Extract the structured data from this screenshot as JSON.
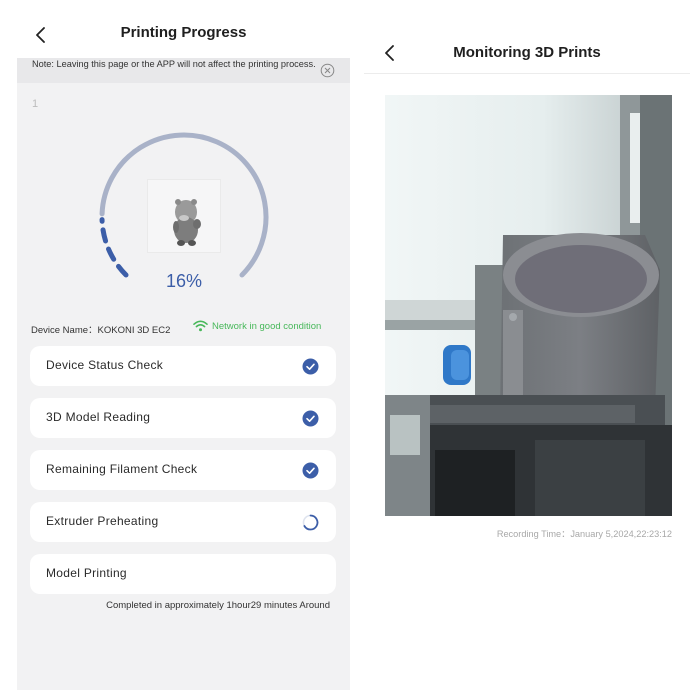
{
  "left": {
    "title": "Printing Progress",
    "notice": "Note: Leaving this page or the APP will not affect the printing process.",
    "index": "1",
    "progress_percent": "16%",
    "progress_value": 0.16,
    "device_label": "Device Name：KOKONI 3D EC2",
    "network_status": "Network in good condition",
    "steps": [
      {
        "label": "Device Status Check",
        "status": "done"
      },
      {
        "label": "3D Model Reading",
        "status": "done"
      },
      {
        "label": "Remaining Filament Check",
        "status": "done"
      },
      {
        "label": "Extruder Preheating",
        "status": "loading"
      },
      {
        "label": "Model Printing",
        "status": "pending"
      }
    ],
    "completion_text": "Completed in approximately 1hour29 minutes Around"
  },
  "right": {
    "title": "Monitoring 3D Prints",
    "recording_time": "Recording Time：January 5,2024,22:23:12"
  },
  "icons": {
    "back": "chevron-left-icon",
    "close": "close-circle-icon",
    "wifi": "wifi-icon",
    "check": "check-circle-icon",
    "spinner": "loading-spinner-icon"
  },
  "colors": {
    "accent": "#3c5ea8",
    "network_green": "#48b85a",
    "ring_track": "#a9b2c8",
    "panel_bg": "#f2f2f3"
  }
}
